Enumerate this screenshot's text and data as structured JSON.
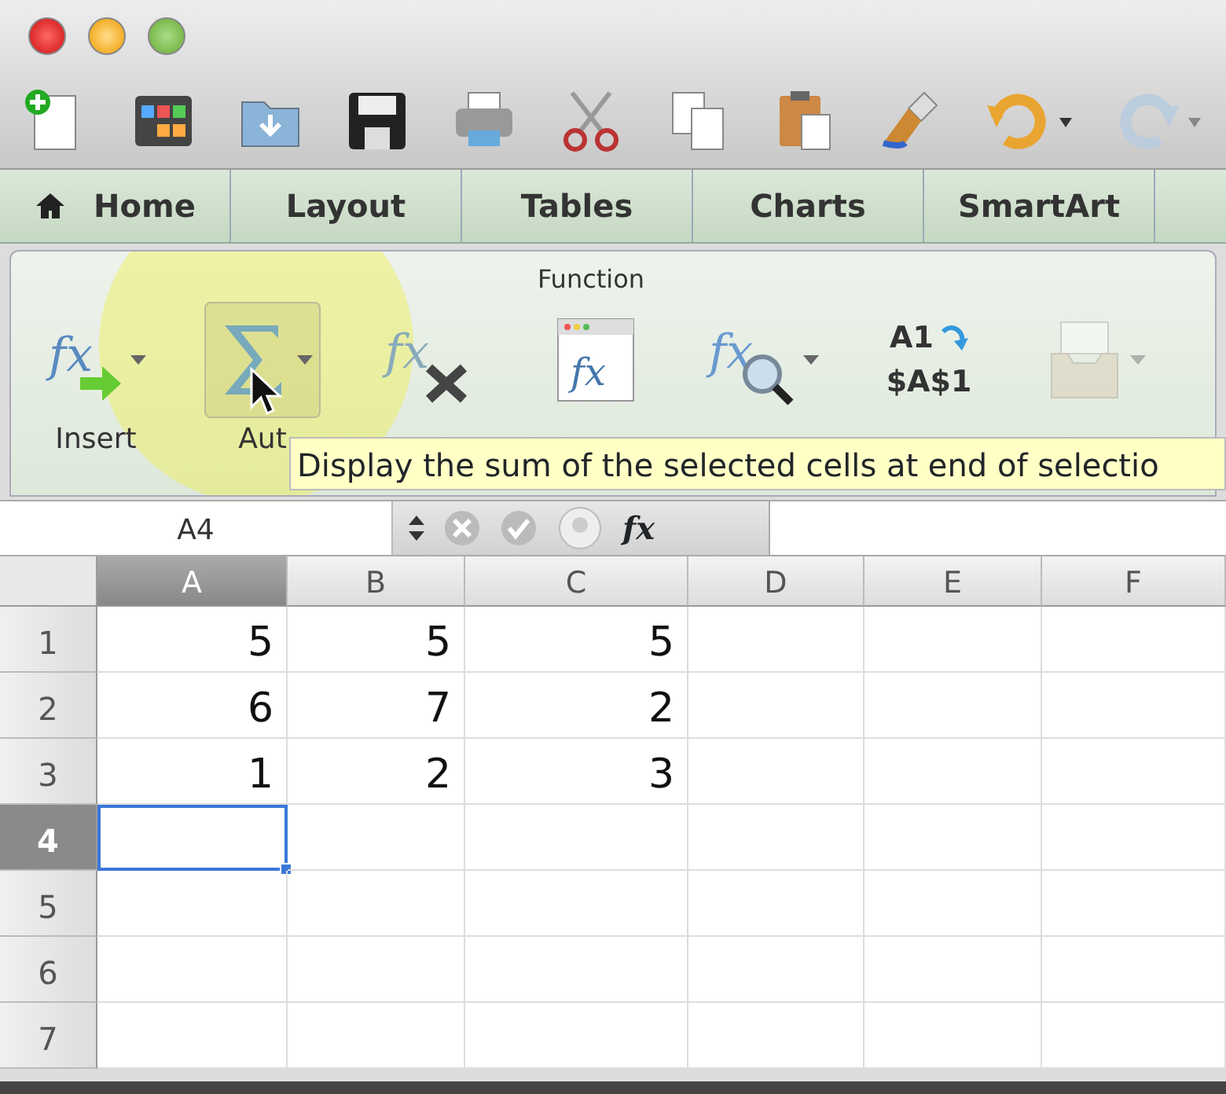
{
  "tabs": [
    {
      "label": "Home",
      "kind": "home"
    },
    {
      "label": "Layout",
      "kind": "plain"
    },
    {
      "label": "Tables",
      "kind": "plain"
    },
    {
      "label": "Charts",
      "kind": "plain"
    },
    {
      "label": "SmartArt",
      "kind": "plain"
    }
  ],
  "ribbon": {
    "group_title": "Function",
    "buttons": [
      {
        "kind": "insert",
        "icon_text": [
          "fx"
        ],
        "label": "Insert",
        "dropdown": true,
        "disabled": false
      },
      {
        "kind": "autosum",
        "label": "Aut",
        "dropdown": true,
        "disabled": false
      },
      {
        "kind": "builder",
        "icon_text": [
          "fx"
        ],
        "dropdown": false,
        "disabled": false
      },
      {
        "kind": "reference",
        "icon_text": [
          "fx"
        ],
        "dropdown": false,
        "disabled": false
      },
      {
        "kind": "lookup",
        "icon_text": [
          "fx"
        ],
        "dropdown": true,
        "disabled": false
      },
      {
        "kind": "switch",
        "icon_text": [
          "A1",
          "$A$1"
        ],
        "dropdown": false,
        "disabled": false
      },
      {
        "kind": "insert_box",
        "dropdown": true,
        "disabled": true
      }
    ]
  },
  "tooltip": "Display the sum of the selected cells at end of selectio",
  "formula_bar": {
    "name_box": "A4",
    "fx": "fx"
  },
  "sheet": {
    "columns": [
      {
        "label": "A",
        "selected": true
      },
      {
        "label": "B",
        "selected": false
      },
      {
        "label": "C",
        "selected": false
      },
      {
        "label": "D",
        "selected": false
      },
      {
        "label": "E",
        "selected": false
      },
      {
        "label": "F",
        "selected": false
      }
    ],
    "rows": [
      {
        "header": "1",
        "selected": false,
        "cells": [
          "5",
          "5",
          "5"
        ]
      },
      {
        "header": "2",
        "selected": false,
        "cells": [
          "6",
          "7",
          "2"
        ]
      },
      {
        "header": "3",
        "selected": false,
        "cells": [
          "1",
          "2",
          "3"
        ]
      },
      {
        "header": "4",
        "selected": true
      },
      {
        "header": "5",
        "selected": false
      },
      {
        "header": "6",
        "selected": false
      },
      {
        "header": "7",
        "selected": false
      }
    ]
  }
}
